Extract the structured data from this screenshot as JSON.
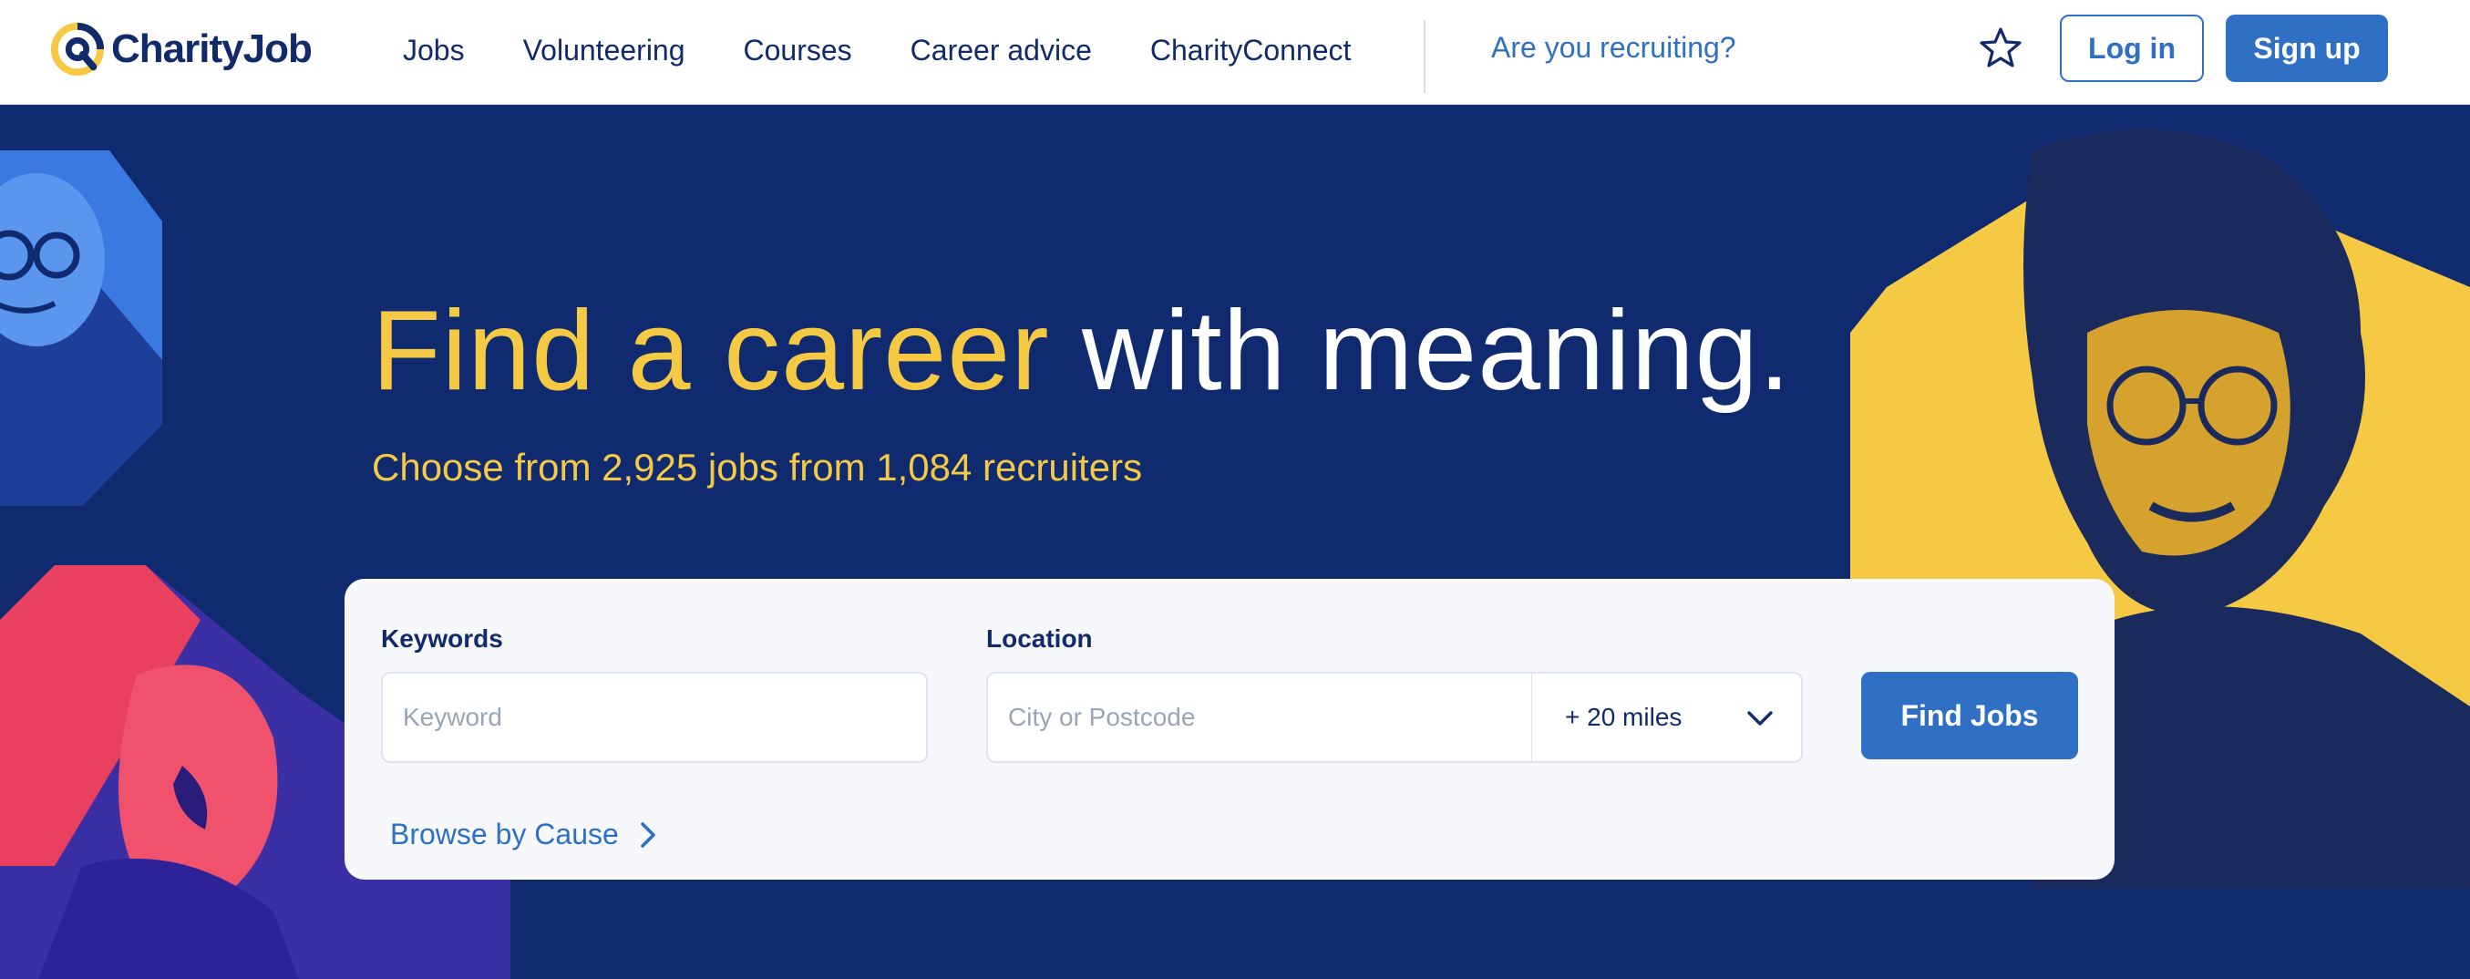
{
  "brand": {
    "name": "CharityJob",
    "colors": {
      "navy": "#102a6b",
      "hero_bg": "#0f2a6e",
      "accent_blue": "#2f6fc4",
      "yellow": "#f6c944",
      "coral": "#e8405e"
    }
  },
  "nav": {
    "items": [
      {
        "label": "Jobs"
      },
      {
        "label": "Volunteering"
      },
      {
        "label": "Courses"
      },
      {
        "label": "Career advice"
      },
      {
        "label": "CharityConnect"
      }
    ],
    "recruit_label": "Are you recruiting?",
    "favourites_icon": "star-icon",
    "login_label": "Log in",
    "signup_label": "Sign up"
  },
  "hero": {
    "headline_part1": "Find a career",
    "headline_part2": "with meaning.",
    "subline": "Choose from 2,925 jobs from 1,084 recruiters"
  },
  "search": {
    "keywords_label": "Keywords",
    "keywords_placeholder": "Keyword",
    "location_label": "Location",
    "location_placeholder": "City or Postcode",
    "radius_selected": "+ 20 miles",
    "submit_label": "Find Jobs",
    "browse_label": "Browse by Cause",
    "browse_icon": "chevron-right-icon",
    "radius_icon": "chevron-down-icon"
  }
}
